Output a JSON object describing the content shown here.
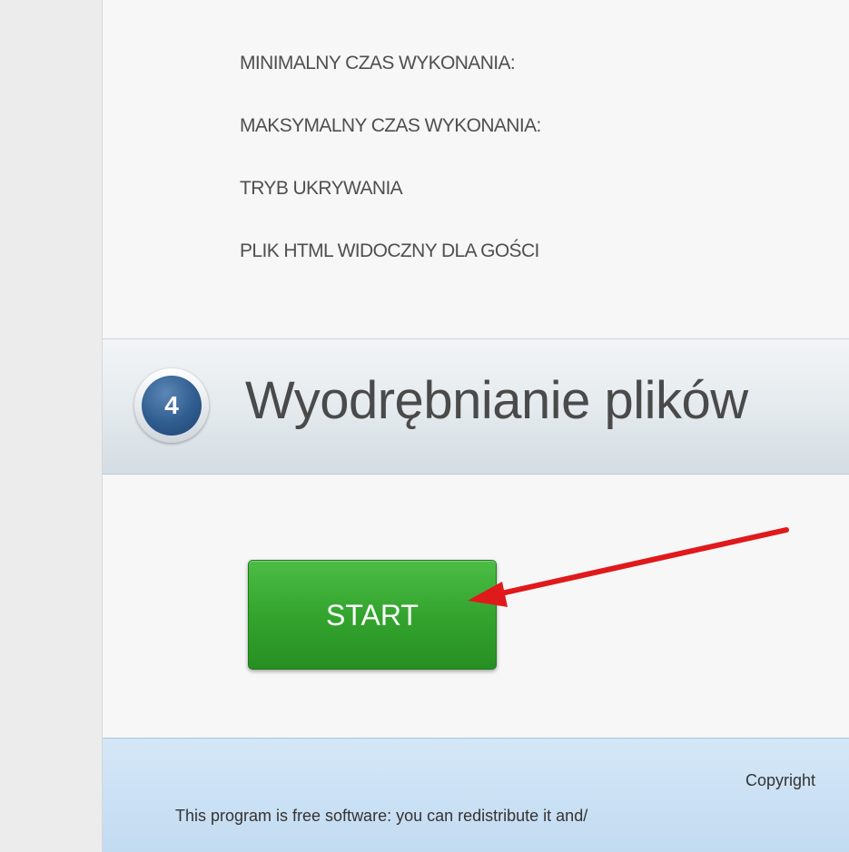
{
  "settings": {
    "items": [
      {
        "label": "MINIMALNY CZAS WYKONANIA:"
      },
      {
        "label": "MAKSYMALNY CZAS WYKONANIA:"
      },
      {
        "label": "TRYB UKRYWANIA"
      },
      {
        "label": "PLIK HTML WIDOCZNY DLA GOŚCI"
      }
    ]
  },
  "step": {
    "number": "4",
    "title": "Wyodrębnianie plików"
  },
  "actions": {
    "start_label": "START"
  },
  "footer": {
    "line1": "Copyright",
    "line2": "This program is free software: you can redistribute it and/"
  },
  "colors": {
    "button_green": "#33a52e",
    "arrow_red": "#e0191b",
    "badge_blue": "#2f5c8f",
    "footer_blue": "#c3dbf1"
  },
  "icons": {
    "step_badge": "numbered-circle-icon",
    "annotation": "red-arrow-icon"
  }
}
